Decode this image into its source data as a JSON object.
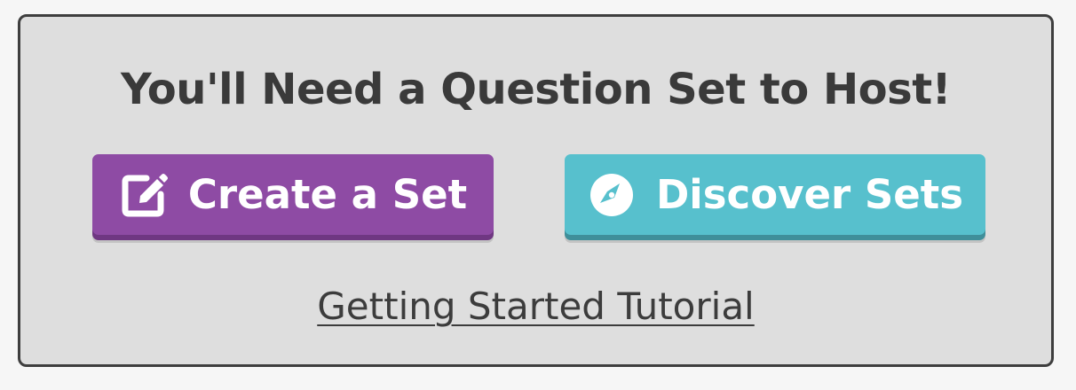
{
  "panel": {
    "title": "You'll Need a Question Set to Host!",
    "buttons": {
      "create": {
        "label": "Create a Set",
        "icon": "edit-icon",
        "color": "#8e4ba4"
      },
      "discover": {
        "label": "Discover Sets",
        "icon": "compass-icon",
        "color": "#57c0cd"
      }
    },
    "tutorial_link": "Getting Started Tutorial"
  }
}
